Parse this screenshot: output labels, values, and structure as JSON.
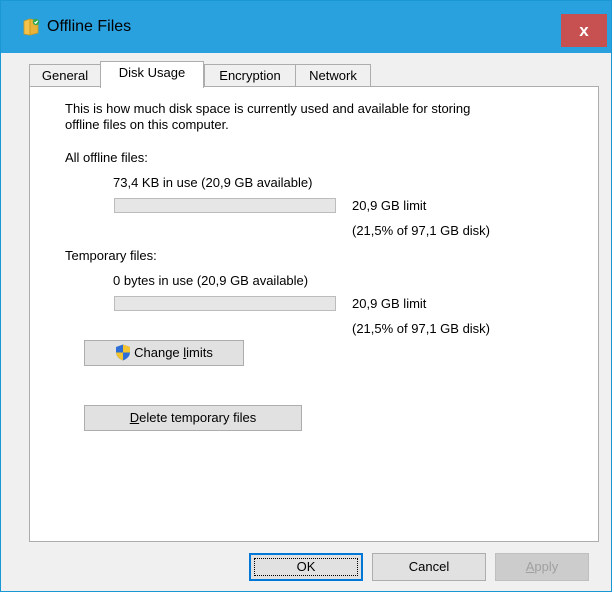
{
  "window": {
    "title": "Offline Files",
    "close_label": "x"
  },
  "tabs": [
    {
      "label": "General"
    },
    {
      "label": "Disk Usage"
    },
    {
      "label": "Encryption"
    },
    {
      "label": "Network"
    }
  ],
  "panel": {
    "description_line1": "This is how much disk space is currently used and available for storing",
    "description_line2": "offline files on this computer.",
    "all_offline": {
      "heading": "All offline files:",
      "usage": "73,4 KB in use (20,9 GB available)",
      "limit": "20,9 GB limit",
      "percent": "(21,5% of 97,1 GB disk)",
      "progress_fraction": 0
    },
    "temporary": {
      "heading": "Temporary files:",
      "usage": "0 bytes in use (20,9 GB available)",
      "limit": "20,9 GB limit",
      "percent": "(21,5% of 97,1 GB disk)",
      "progress_fraction": 0
    },
    "change_limits": {
      "prefix": "Change ",
      "underlined": "l",
      "suffix": "imits",
      "icon": "uac-shield-icon"
    },
    "delete_temp": {
      "underlined": "D",
      "suffix": "elete temporary files"
    }
  },
  "footer": {
    "ok_label": "OK",
    "cancel_label": "Cancel",
    "apply_underlined": "A",
    "apply_suffix": "pply"
  },
  "colors": {
    "titlebar": "#2aa1df",
    "close": "#c75050",
    "progress": "#06b025"
  }
}
